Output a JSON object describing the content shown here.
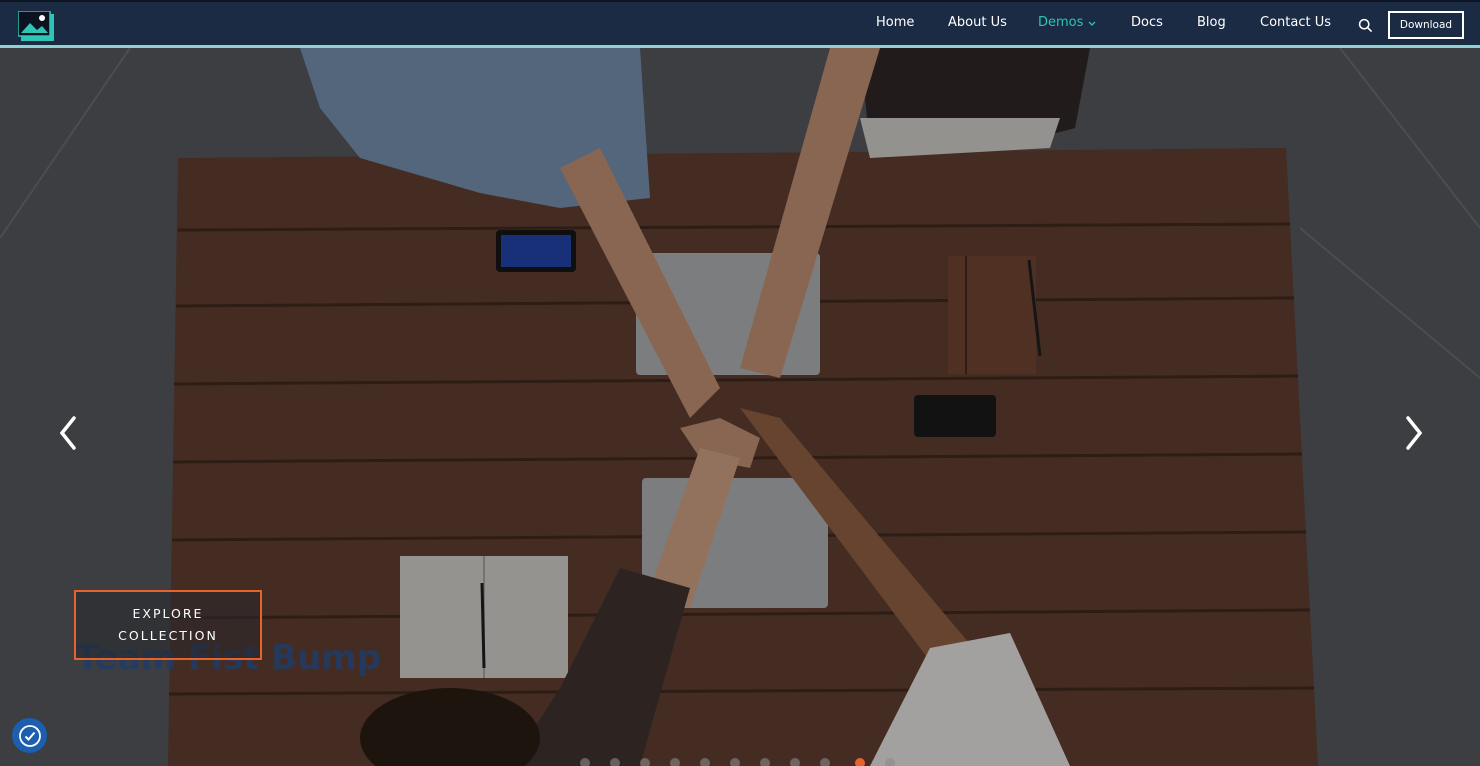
{
  "navbar": {
    "logo_icon": "image-logo-icon",
    "items": [
      {
        "label": "Home"
      },
      {
        "label": "About Us"
      },
      {
        "label": "Demos",
        "active": true
      },
      {
        "label": "Docs"
      },
      {
        "label": "Blog"
      },
      {
        "label": "Contact Us"
      }
    ],
    "search_icon": "search-icon",
    "download_label": "Download",
    "accent_color": "#2ec4b6",
    "bg_color": "#1b2b44"
  },
  "hero": {
    "cta_label": "EXPLORE COLLECTION",
    "headline": "Team Fist Bump",
    "prev_icon": "chevron-left-icon",
    "next_icon": "chevron-right-icon",
    "slide_count": 11,
    "active_slide": 10,
    "accent_color": "#e8622c"
  },
  "accessibility": {
    "icon": "accessibility-icon",
    "color": "#1c5fae"
  }
}
